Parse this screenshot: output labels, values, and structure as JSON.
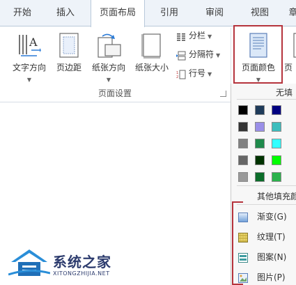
{
  "tabs": [
    {
      "label": "开始",
      "active": false
    },
    {
      "label": "插入",
      "active": false
    },
    {
      "label": "页面布局",
      "active": true
    },
    {
      "label": "引用",
      "active": false
    },
    {
      "label": "审阅",
      "active": false
    },
    {
      "label": "视图",
      "active": false
    },
    {
      "label": "章",
      "active": false
    }
  ],
  "ribbon": {
    "buttons": {
      "text_direction": "文字方向",
      "margins": "页边距",
      "orientation": "纸张方向",
      "size": "纸张大小",
      "page_color": "页面颜色",
      "page_border_partial": "页"
    },
    "small": {
      "columns": "分栏",
      "breaks": "分隔符",
      "line_numbers": "行号"
    },
    "group_label": "页面设置"
  },
  "dropdown": {
    "no_fill": "无填",
    "more_fill": "其他填充颜",
    "swatch_colors": [
      [
        "#000000",
        "#1f3b5a",
        "#000080",
        "#2b6bd6",
        "#1e90ff"
      ],
      [
        "#333333",
        "#9a8fe8",
        "#3cbdbd",
        "#22cccc",
        "#22dddd"
      ],
      [
        "#808080",
        "#1f8a4c",
        "#33ffff",
        "#22e0a0",
        "#44ffcc"
      ],
      [
        "#666666",
        "#003300",
        "#00ff00",
        "#d8ff00",
        "#ffff00"
      ],
      [
        "#999999",
        "#0b6d2a",
        "#2bb24c",
        "#8abf1a",
        "#b3c21a"
      ]
    ],
    "fill_effects": [
      {
        "label": "渐变(G)",
        "icon": "gradient-icon"
      },
      {
        "label": "纹理(T)",
        "icon": "texture-icon"
      },
      {
        "label": "图案(N)",
        "icon": "pattern-icon"
      },
      {
        "label": "图片(P)",
        "icon": "picture-icon"
      }
    ]
  },
  "watermark": {
    "title": "系统之家",
    "subtitle": "XITONGZHIJIA.NET"
  },
  "colors": {
    "highlight": "#b5333c",
    "tab_bar": "#eef3f9",
    "brand": "#2d3c6e"
  }
}
